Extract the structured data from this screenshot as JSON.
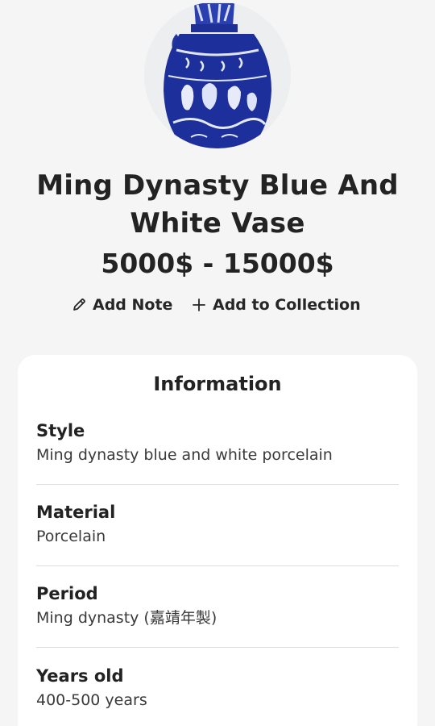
{
  "product": {
    "title": "Ming Dynasty Blue And White Vase",
    "price": "5000$ - 15000$",
    "image_icon": "vase-photo"
  },
  "actions": {
    "add_note_label": "Add Note",
    "add_note_icon": "pencil-icon",
    "add_collection_label": "Add to Collection",
    "add_collection_icon": "plus-icon"
  },
  "information": {
    "title": "Information",
    "rows": [
      {
        "label": "Style",
        "value": "Ming dynasty blue and white porcelain"
      },
      {
        "label": "Material",
        "value": "Porcelain"
      },
      {
        "label": "Period",
        "value": "Ming dynasty (嘉靖年製)"
      },
      {
        "label": "Years old",
        "value": "400-500 years"
      }
    ]
  },
  "colors": {
    "background": "#f5f5f5",
    "card": "#ffffff",
    "text": "#232323",
    "vase_blue": "#1b2f9c"
  }
}
